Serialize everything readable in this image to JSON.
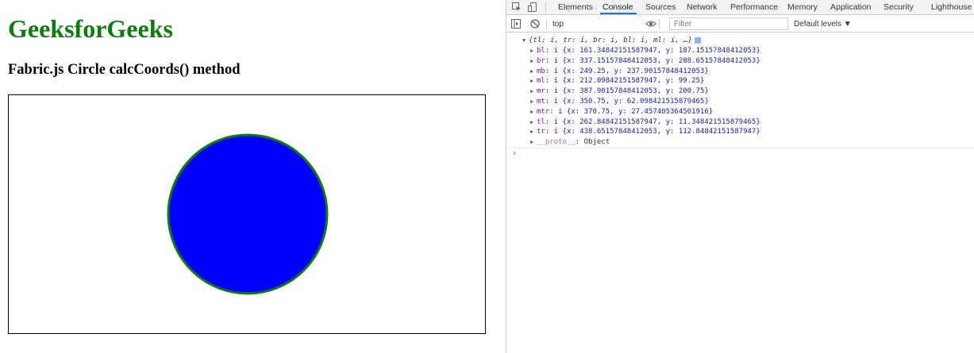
{
  "page": {
    "title": "GeeksforGeeks",
    "heading": "Fabric.js Circle calcCoords() method",
    "circle": {
      "fill": "#0000ff",
      "stroke": "#0f7c0f"
    }
  },
  "devtools": {
    "tabs": [
      {
        "label": "Elements"
      },
      {
        "label": "Console"
      },
      {
        "label": "Sources"
      },
      {
        "label": "Network"
      },
      {
        "label": "Performance"
      },
      {
        "label": "Memory"
      },
      {
        "label": "Application"
      },
      {
        "label": "Security"
      },
      {
        "label": "Lighthouse"
      }
    ],
    "active_tab": "Console",
    "toolbar": {
      "context": "top",
      "filter_placeholder": "Filter",
      "levels": "Default levels ▼"
    },
    "console": {
      "summary": "{tl: i, tr: i, br: i, bl: i, ml: i, …}",
      "entries": [
        {
          "key": "bl",
          "value": "i {x: 161.34842151587947, y: 187.15157848412053}"
        },
        {
          "key": "br",
          "value": "i {x: 337.15157848412053, y: 288.65157848412053}"
        },
        {
          "key": "mb",
          "value": "i {x: 249.25, y: 237.90157848412053}"
        },
        {
          "key": "ml",
          "value": "i {x: 212.09842151587947, y: 99.25}"
        },
        {
          "key": "mr",
          "value": "i {x: 387.90157848412053, y: 200.75}"
        },
        {
          "key": "mt",
          "value": "i {x: 350.75, y: 62.098421515879465}"
        },
        {
          "key": "mtr",
          "value": "i {x: 370.75, y: 27.457405364501916}"
        },
        {
          "key": "tl",
          "value": "i {x: 262.84842151587947, y: 11.348421515879465}"
        },
        {
          "key": "tr",
          "value": "i {x: 438.65157848412053, y: 112.84842151587947}"
        }
      ],
      "proto": {
        "key": "__proto__",
        "value": "Object"
      },
      "prompt": "›"
    }
  }
}
